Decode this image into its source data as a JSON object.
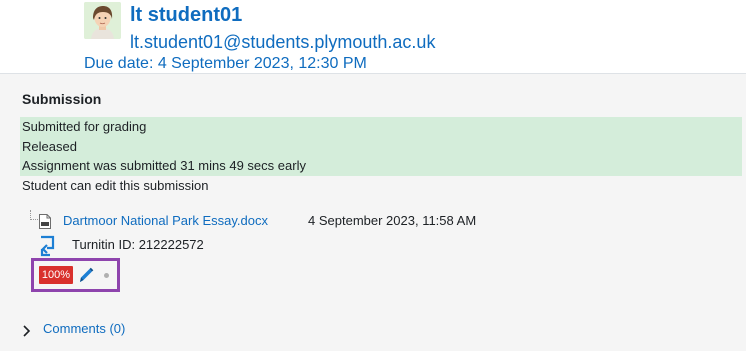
{
  "student": {
    "name": "lt student01",
    "email": "lt.student01@students.plymouth.ac.uk",
    "due_date": "Due date: 4 September 2023, 12:30 PM",
    "avatar_icon": "user-avatar-icon"
  },
  "submission": {
    "title": "Submission",
    "status_lines": [
      "Submitted for grading",
      "Released",
      "Assignment was submitted 31 mins 49 secs early",
      "Student can edit this submission"
    ],
    "file": {
      "name": "Dartmoor National Park Essay.docx",
      "date": "4 September 2023, 11:58 AM",
      "icon": "document-file-icon"
    },
    "turnitin": {
      "label": "Turnitin ID: 212222572",
      "icon": "turnitin-icon"
    },
    "similarity": {
      "score": "100%",
      "color": "#d9302c"
    },
    "comments_label": "Comments (0)"
  },
  "colors": {
    "accent": "#0f6cbf",
    "highlight_green": "#d4edda",
    "annotation_border": "#8e44ad"
  }
}
